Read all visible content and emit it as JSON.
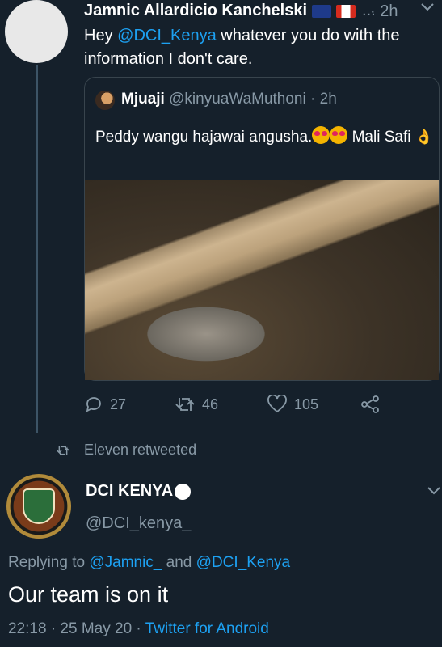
{
  "tweet1": {
    "author_name": "Jamnic Allardicio Kanchelski",
    "ellipsis": "...",
    "time": "· 2h",
    "text_mention": "@DCI_Kenya",
    "text_prefix": "Hey",
    "text_suffix": "whatever you do with the information I don't care.",
    "quote": {
      "author_name": "Mjuaji",
      "author_handle": "@kinyuaWaMuthoni",
      "time": "· 2h",
      "text_part1": "Peddy wangu hajawai angusha.",
      "text_part2": "Mali Safi"
    },
    "actions": {
      "replies": "27",
      "retweets": "46",
      "likes": "105"
    }
  },
  "retweet_label": "Eleven retweeted",
  "tweet2": {
    "author_name": "DCI KENYA",
    "author_handle": "@DCI_kenya_",
    "reply_prefix": "Replying to",
    "reply_to_1": "@Jamnic_",
    "reply_and": "and",
    "reply_to_2": "@DCI_Kenya",
    "text": "Our team is on it",
    "datetime": "22:18 · 25 May 20 ·",
    "source": "Twitter for Android"
  },
  "colors": {
    "background": "#15202b",
    "muted": "#8899a6",
    "link": "#1da1f2",
    "border": "#38444d"
  }
}
